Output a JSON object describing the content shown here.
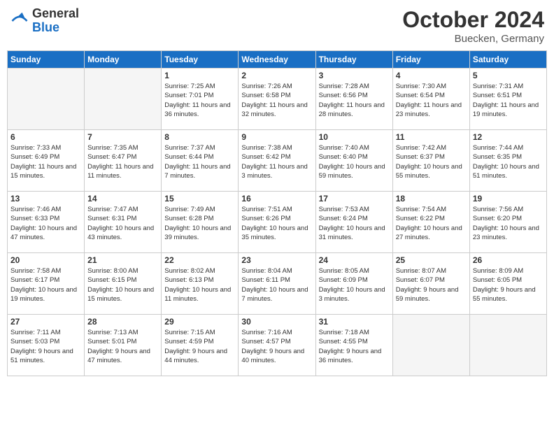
{
  "header": {
    "logo_line1": "General",
    "logo_line2": "Blue",
    "month": "October 2024",
    "location": "Buecken, Germany"
  },
  "days_of_week": [
    "Sunday",
    "Monday",
    "Tuesday",
    "Wednesday",
    "Thursday",
    "Friday",
    "Saturday"
  ],
  "weeks": [
    [
      {
        "day": "",
        "info": ""
      },
      {
        "day": "",
        "info": ""
      },
      {
        "day": "1",
        "info": "Sunrise: 7:25 AM\nSunset: 7:01 PM\nDaylight: 11 hours and 36 minutes."
      },
      {
        "day": "2",
        "info": "Sunrise: 7:26 AM\nSunset: 6:58 PM\nDaylight: 11 hours and 32 minutes."
      },
      {
        "day": "3",
        "info": "Sunrise: 7:28 AM\nSunset: 6:56 PM\nDaylight: 11 hours and 28 minutes."
      },
      {
        "day": "4",
        "info": "Sunrise: 7:30 AM\nSunset: 6:54 PM\nDaylight: 11 hours and 23 minutes."
      },
      {
        "day": "5",
        "info": "Sunrise: 7:31 AM\nSunset: 6:51 PM\nDaylight: 11 hours and 19 minutes."
      }
    ],
    [
      {
        "day": "6",
        "info": "Sunrise: 7:33 AM\nSunset: 6:49 PM\nDaylight: 11 hours and 15 minutes."
      },
      {
        "day": "7",
        "info": "Sunrise: 7:35 AM\nSunset: 6:47 PM\nDaylight: 11 hours and 11 minutes."
      },
      {
        "day": "8",
        "info": "Sunrise: 7:37 AM\nSunset: 6:44 PM\nDaylight: 11 hours and 7 minutes."
      },
      {
        "day": "9",
        "info": "Sunrise: 7:38 AM\nSunset: 6:42 PM\nDaylight: 11 hours and 3 minutes."
      },
      {
        "day": "10",
        "info": "Sunrise: 7:40 AM\nSunset: 6:40 PM\nDaylight: 10 hours and 59 minutes."
      },
      {
        "day": "11",
        "info": "Sunrise: 7:42 AM\nSunset: 6:37 PM\nDaylight: 10 hours and 55 minutes."
      },
      {
        "day": "12",
        "info": "Sunrise: 7:44 AM\nSunset: 6:35 PM\nDaylight: 10 hours and 51 minutes."
      }
    ],
    [
      {
        "day": "13",
        "info": "Sunrise: 7:46 AM\nSunset: 6:33 PM\nDaylight: 10 hours and 47 minutes."
      },
      {
        "day": "14",
        "info": "Sunrise: 7:47 AM\nSunset: 6:31 PM\nDaylight: 10 hours and 43 minutes."
      },
      {
        "day": "15",
        "info": "Sunrise: 7:49 AM\nSunset: 6:28 PM\nDaylight: 10 hours and 39 minutes."
      },
      {
        "day": "16",
        "info": "Sunrise: 7:51 AM\nSunset: 6:26 PM\nDaylight: 10 hours and 35 minutes."
      },
      {
        "day": "17",
        "info": "Sunrise: 7:53 AM\nSunset: 6:24 PM\nDaylight: 10 hours and 31 minutes."
      },
      {
        "day": "18",
        "info": "Sunrise: 7:54 AM\nSunset: 6:22 PM\nDaylight: 10 hours and 27 minutes."
      },
      {
        "day": "19",
        "info": "Sunrise: 7:56 AM\nSunset: 6:20 PM\nDaylight: 10 hours and 23 minutes."
      }
    ],
    [
      {
        "day": "20",
        "info": "Sunrise: 7:58 AM\nSunset: 6:17 PM\nDaylight: 10 hours and 19 minutes."
      },
      {
        "day": "21",
        "info": "Sunrise: 8:00 AM\nSunset: 6:15 PM\nDaylight: 10 hours and 15 minutes."
      },
      {
        "day": "22",
        "info": "Sunrise: 8:02 AM\nSunset: 6:13 PM\nDaylight: 10 hours and 11 minutes."
      },
      {
        "day": "23",
        "info": "Sunrise: 8:04 AM\nSunset: 6:11 PM\nDaylight: 10 hours and 7 minutes."
      },
      {
        "day": "24",
        "info": "Sunrise: 8:05 AM\nSunset: 6:09 PM\nDaylight: 10 hours and 3 minutes."
      },
      {
        "day": "25",
        "info": "Sunrise: 8:07 AM\nSunset: 6:07 PM\nDaylight: 9 hours and 59 minutes."
      },
      {
        "day": "26",
        "info": "Sunrise: 8:09 AM\nSunset: 6:05 PM\nDaylight: 9 hours and 55 minutes."
      }
    ],
    [
      {
        "day": "27",
        "info": "Sunrise: 7:11 AM\nSunset: 5:03 PM\nDaylight: 9 hours and 51 minutes."
      },
      {
        "day": "28",
        "info": "Sunrise: 7:13 AM\nSunset: 5:01 PM\nDaylight: 9 hours and 47 minutes."
      },
      {
        "day": "29",
        "info": "Sunrise: 7:15 AM\nSunset: 4:59 PM\nDaylight: 9 hours and 44 minutes."
      },
      {
        "day": "30",
        "info": "Sunrise: 7:16 AM\nSunset: 4:57 PM\nDaylight: 9 hours and 40 minutes."
      },
      {
        "day": "31",
        "info": "Sunrise: 7:18 AM\nSunset: 4:55 PM\nDaylight: 9 hours and 36 minutes."
      },
      {
        "day": "",
        "info": ""
      },
      {
        "day": "",
        "info": ""
      }
    ]
  ]
}
